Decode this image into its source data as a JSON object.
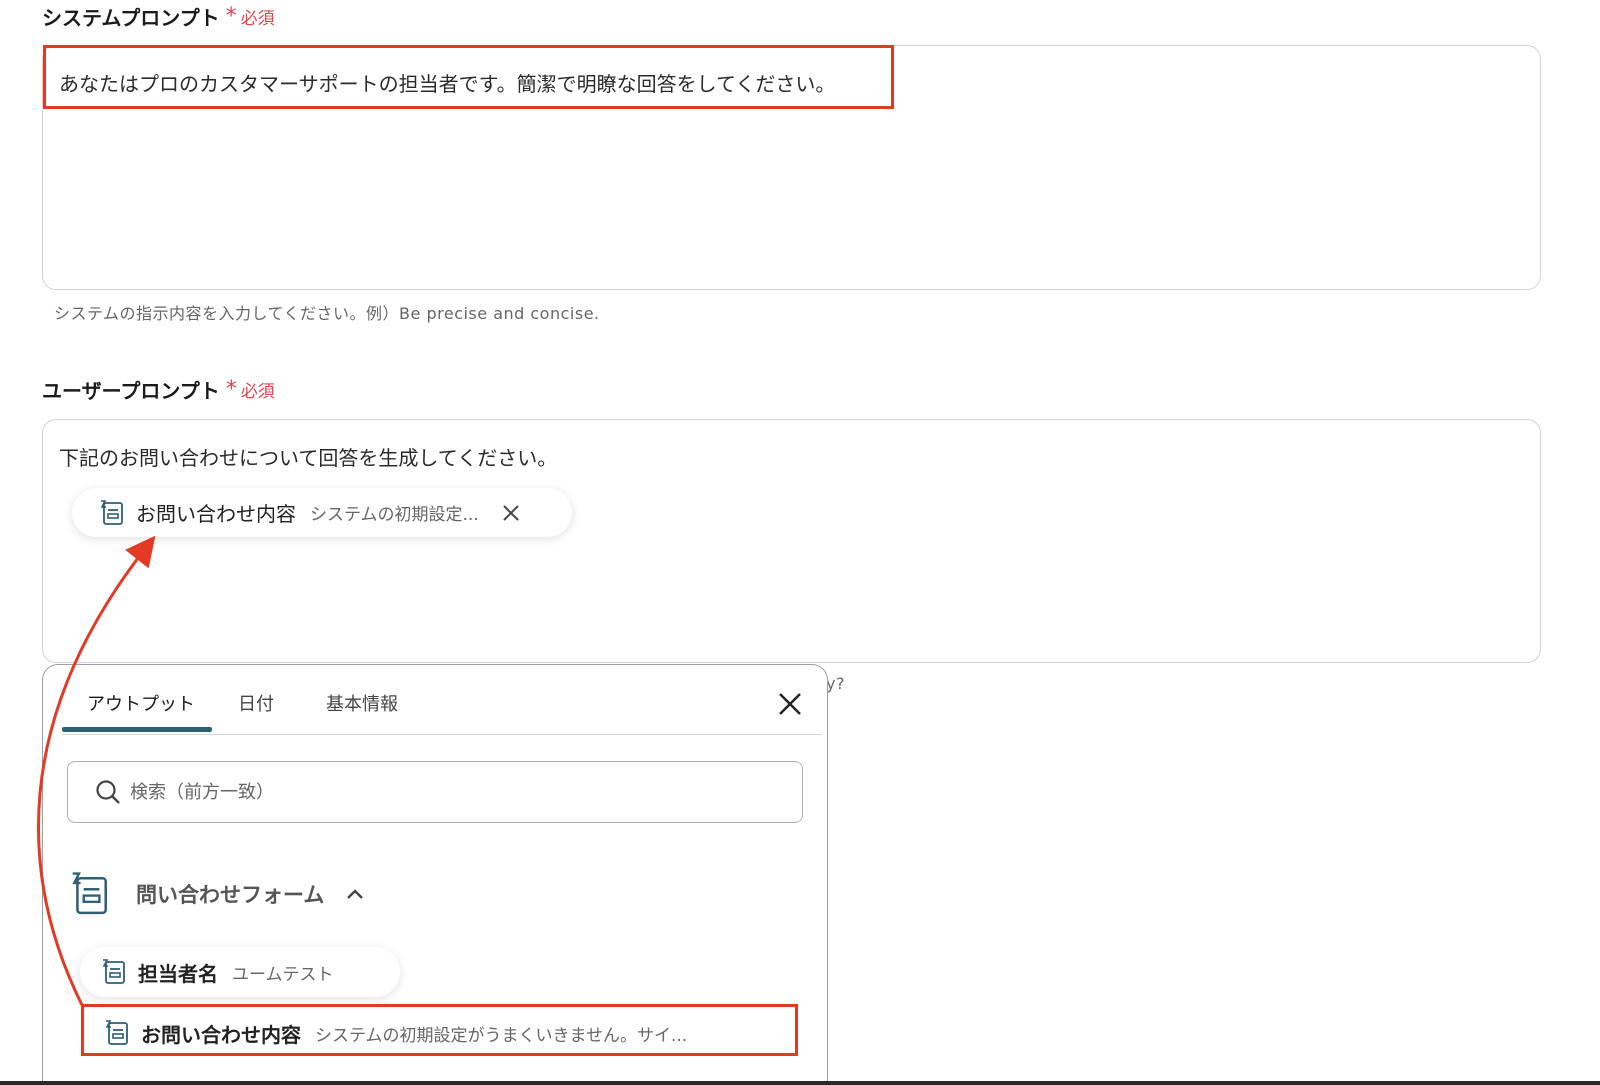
{
  "system_prompt": {
    "label": "システムプロンプト",
    "required": "必須",
    "value": "あなたはプロのカスタマーサポートの担当者です。簡潔で明瞭な回答をしてください。",
    "help": "システムの指示内容を入力してください。例）Be precise and concise."
  },
  "user_prompt": {
    "label": "ユーザープロンプト",
    "required": "必須",
    "value": "下記のお問い合わせについて回答を生成してください。",
    "help_fragment": "y?",
    "chip": {
      "name": "お問い合わせ内容",
      "value": "システムの初期設定..."
    }
  },
  "output_panel": {
    "tabs": [
      {
        "label": "アウトプット",
        "active": true
      },
      {
        "label": "日付",
        "active": false
      },
      {
        "label": "基本情報",
        "active": false
      }
    ],
    "search_placeholder": "検索（前方一致）",
    "group": {
      "name": "問い合わせフォーム",
      "items": [
        {
          "name": "担当者名",
          "value": "ユームテスト"
        },
        {
          "name": "お問い合わせ内容",
          "value": "システムの初期設定がうまくいきません。サイ..."
        }
      ]
    }
  },
  "colors": {
    "accent": "#e23a24",
    "required": "#e0444e",
    "tab_indicator": "#2f5f75"
  }
}
